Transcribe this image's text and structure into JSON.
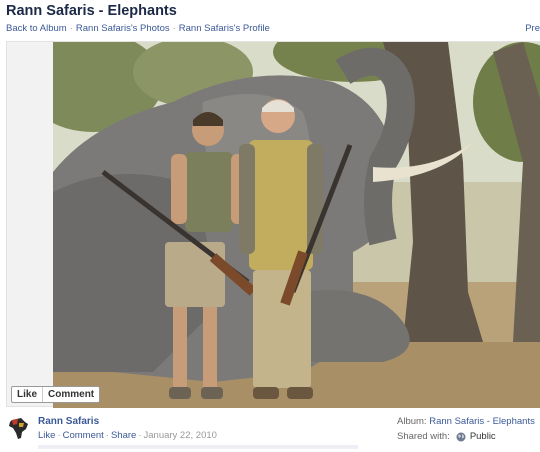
{
  "page": {
    "title": "Rann Safaris - Elephants"
  },
  "breadcrumb": {
    "back_to_album": "Back to Album",
    "photos": "Rann Safaris's Photos",
    "profile": "Rann Safaris's Profile",
    "separator": "·",
    "next": "Pre"
  },
  "photo_actions": {
    "like": "Like",
    "comment": "Comment"
  },
  "footer": {
    "owner_name": "Rann Safaris",
    "like": "Like",
    "comment": "Comment",
    "share": "Share",
    "separator": "·",
    "date": "January 22, 2010",
    "album_label": "Album:",
    "album_name": "Rann Safaris - Elephants",
    "shared_label": "Shared with:",
    "audience": "Public"
  },
  "colors": {
    "link": "#3b5998",
    "title": "#1c2a47",
    "muted": "#999999"
  },
  "icons": {
    "owner_avatar": "africa-map-icon",
    "audience": "globe-icon"
  }
}
